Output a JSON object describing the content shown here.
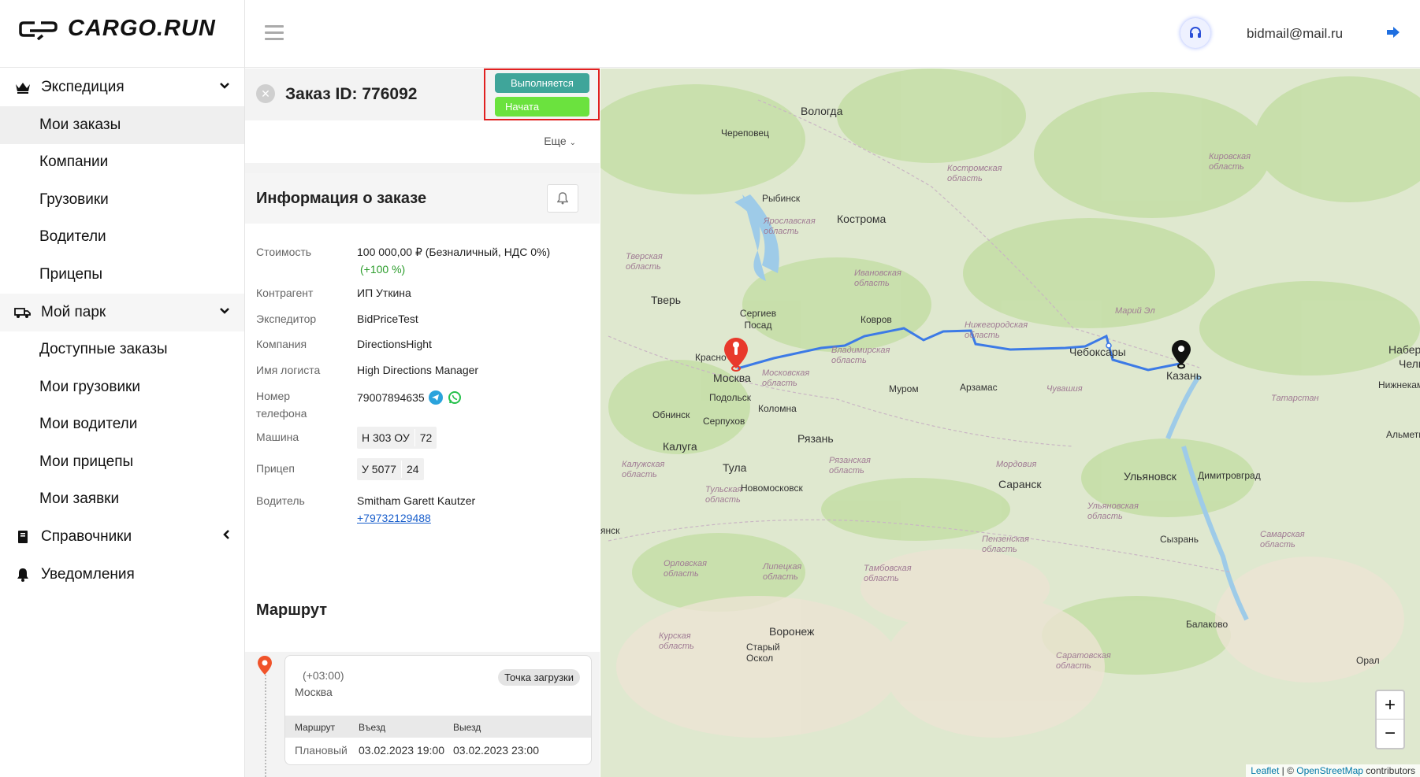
{
  "app": {
    "logo_text": "CARGO.RUN",
    "user_email": "bidmail@mail.ru"
  },
  "sidebar": {
    "sections": [
      {
        "label": "Экспедиция",
        "items": [
          "Мои заказы",
          "Компании",
          "Грузовики",
          "Водители",
          "Прицепы"
        ]
      },
      {
        "label": "Мой парк",
        "items": [
          "Доступные заказы",
          "Мои грузовики",
          "Мои водители",
          "Мои прицепы",
          "Мои заявки"
        ]
      },
      {
        "label": "Справочники"
      },
      {
        "label": "Уведомления"
      }
    ],
    "active_item": "Мои заказы"
  },
  "order": {
    "title": "Заказ ID: 776092",
    "status_primary": "Выполняется",
    "status_secondary": "Начата",
    "more_label": "Еще",
    "info_title": "Информация о заказе",
    "fields": {
      "cost_label": "Стоимость",
      "cost_value": "100 000,00 ₽ (Безналичный, НДС 0%)",
      "cost_delta": "(+100 %)",
      "counterparty_label": "Контрагент",
      "counterparty_value": "ИП Уткина",
      "forwarder_label": "Экспедитор",
      "forwarder_value": "BidPriceTest",
      "company_label": "Компания",
      "company_value": "DirectionsHight",
      "logist_label": "Имя логиста",
      "logist_value": "High Directions Manager",
      "phone_label_line1": "Номер",
      "phone_label_line2": "телефона",
      "phone_value": "79007894635",
      "truck_label": "Машина",
      "truck_plate": "Н 303 ОУ",
      "truck_region": "72",
      "trailer_label": "Прицеп",
      "trailer_plate": "У 5077",
      "trailer_region": "24",
      "driver_label": "Водитель",
      "driver_name": "Smitham Garett Kautzer",
      "driver_phone": "+79732129488"
    },
    "route": {
      "title": "Маршрут",
      "timezone": "(+03:00)",
      "city": "Москва",
      "point_type": "Точка загрузки",
      "table_headers": [
        "Маршрут",
        "Въезд",
        "Выезд"
      ],
      "table_row": [
        "Плановый",
        "03.02.2023 19:00",
        "03.02.2023 23:00"
      ]
    }
  },
  "map": {
    "cities": [
      "Вологда",
      "Череповец",
      "Рыбинск",
      "Кострома",
      "Тверь",
      "Сергиев Посад",
      "Ковров",
      "Красно",
      "Москва",
      "Подольск",
      "Обнинск",
      "Серпухов",
      "Коломна",
      "Муром",
      "Арзамас",
      "Чебоксары",
      "Казань",
      "Набере",
      "Челн",
      "Нижнекамск",
      "Альметь",
      "Калуга",
      "Тула",
      "Новомосковск",
      "Рязань",
      "Саранск",
      "Ульяновск",
      "Димитровград",
      "Сызрань",
      "Балаково",
      "Воронеж",
      "Старый Оскол",
      "янск",
      "Орал"
    ],
    "regions": [
      "Кировская область",
      "Костромская область",
      "Ярославская область",
      "Тверская область",
      "Ивановская область",
      "Владимирская область",
      "Нижегородская область",
      "Марий Эл",
      "Московская область",
      "Чувашия",
      "Татарстан",
      "Калужская область",
      "Тульская область",
      "Рязанская область",
      "Мордовия",
      "Ульяновская область",
      "Пензенская область",
      "Самарская область",
      "Орловская область",
      "Липецкая область",
      "Тамбовская область",
      "Курская область",
      "Саратовская область"
    ],
    "zoom_in": "+",
    "zoom_out": "−",
    "attribution_leaflet": "Leaflet",
    "attribution_sep": " | © ",
    "attribution_osm": "OpenStreetMap",
    "attribution_tail": " contributors",
    "route_color": "#3c7ae6",
    "origin_marker_color": "#e8392b",
    "destination_marker_color": "#111111"
  }
}
